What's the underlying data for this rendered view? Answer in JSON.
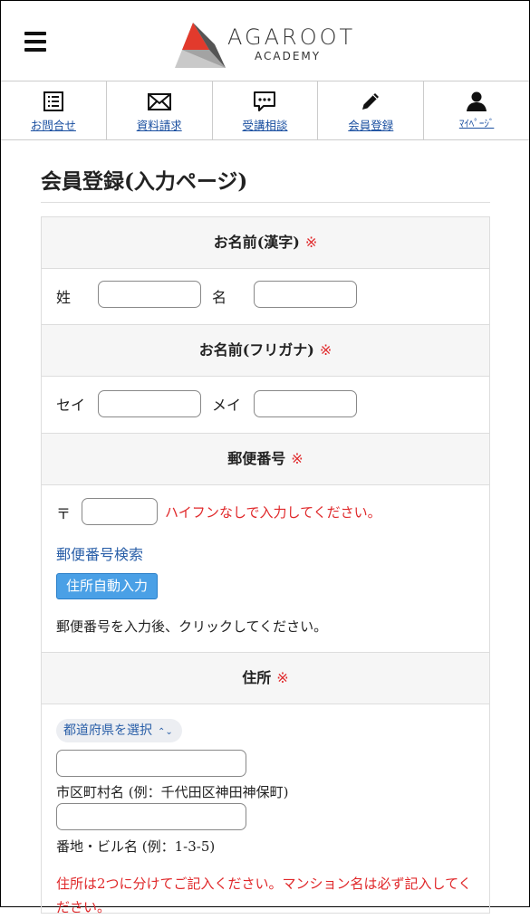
{
  "header": {
    "logo_main": "AGAROOT",
    "logo_sub": "ACADEMY"
  },
  "nav": [
    {
      "label": "お問合せ",
      "icon": "list-document-icon"
    },
    {
      "label": "資料請求",
      "icon": "envelope-icon"
    },
    {
      "label": "受講相談",
      "icon": "chat-bubble-icon"
    },
    {
      "label": "会員登録",
      "icon": "pencil-icon"
    },
    {
      "label": "ﾏｲﾍﾟｰｼﾞ",
      "icon": "person-icon"
    }
  ],
  "page": {
    "title": "会員登録(入力ページ)"
  },
  "required_mark": "※",
  "form": {
    "name_kanji": {
      "heading": "お名前(漢字)",
      "last_label": "姓",
      "first_label": "名"
    },
    "name_kana": {
      "heading": "お名前(フリガナ)",
      "last_label": "セイ",
      "first_label": "メイ"
    },
    "postal": {
      "heading": "郵便番号",
      "prefix": "〒",
      "hint": "ハイフンなしで入力してください。",
      "search_link": "郵便番号検索",
      "auto_button": "住所自動入力",
      "after_note": "郵便番号を入力後、クリックしてください。"
    },
    "address": {
      "heading": "住所",
      "prefecture_select": "都道府県を選択",
      "city_caption": "市区町村名 (例：千代田区神田神保町)",
      "street_caption": "番地・ビル名 (例：1-3-5)",
      "warning": "住所は2つに分けてご記入ください。マンション名は必ず記入してください。"
    }
  },
  "colors": {
    "required": "#e0282a",
    "link": "#2a5fa8",
    "button": "#4aa0e6"
  }
}
